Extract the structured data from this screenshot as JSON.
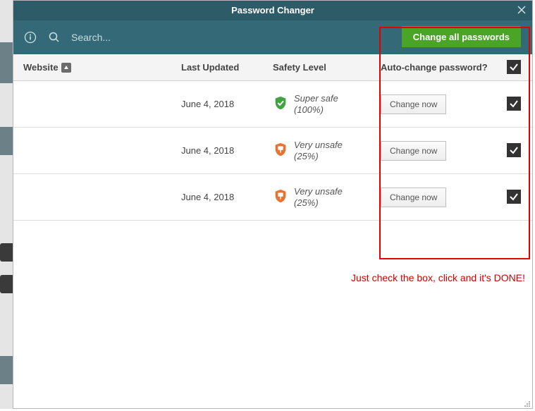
{
  "window": {
    "title": "Password Changer"
  },
  "toolbar": {
    "search_placeholder": "Search...",
    "change_all_label": "Change all passwords"
  },
  "headers": {
    "website": "Website",
    "last_updated": "Last Updated",
    "safety": "Safety Level",
    "auto_change": "Auto-change password?"
  },
  "rows": [
    {
      "last_updated": "June 4, 2018",
      "safety_label": "Super safe",
      "safety_pct": "(100%)",
      "safety_kind": "safe",
      "change_btn": "Change now",
      "checked": true
    },
    {
      "last_updated": "June 4, 2018",
      "safety_label": "Very unsafe",
      "safety_pct": "(25%)",
      "safety_kind": "unsafe",
      "change_btn": "Change now",
      "checked": true
    },
    {
      "last_updated": "June 4, 2018",
      "safety_label": "Very unsafe",
      "safety_pct": "(25%)",
      "safety_kind": "unsafe",
      "change_btn": "Change now",
      "checked": true
    }
  ],
  "callout": "Just check the box, click and it's DONE!"
}
